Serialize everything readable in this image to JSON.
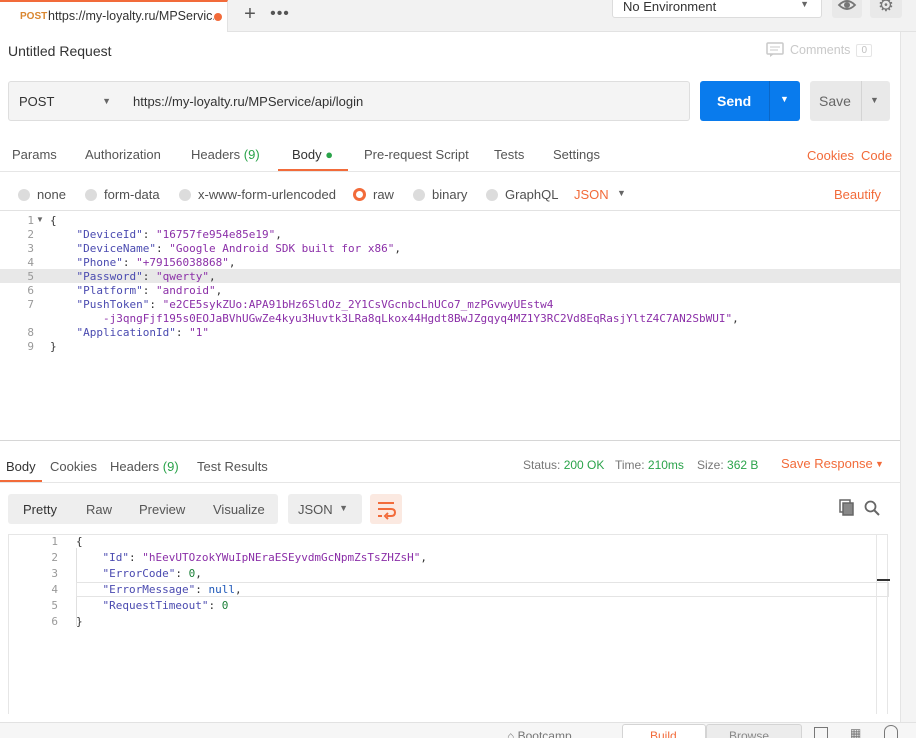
{
  "tab": {
    "method": "POST",
    "url": "https://my-loyalty.ru/MPServic..."
  },
  "topbar": {
    "add_label": "+",
    "more_label": "•••",
    "environment": "No Environment"
  },
  "request": {
    "title": "Untitled Request",
    "comments_label": "Comments",
    "comments_count": "0",
    "method": "POST",
    "url": "https://my-loyalty.ru/MPService/api/login",
    "send_label": "Send",
    "save_label": "Save"
  },
  "request_tabs": {
    "params": "Params",
    "authorization": "Authorization",
    "headers": "Headers",
    "headers_count": "(9)",
    "body": "Body",
    "prerequest": "Pre-request Script",
    "tests": "Tests",
    "settings": "Settings",
    "cookies": "Cookies",
    "code": "Code"
  },
  "body_options": {
    "none": "none",
    "form_data": "form-data",
    "urlencoded": "x-www-form-urlencoded",
    "raw": "raw",
    "binary": "binary",
    "graphql": "GraphQL",
    "format": "JSON",
    "beautify": "Beautify"
  },
  "request_body": {
    "line_numbers": [
      "1",
      "2",
      "3",
      "4",
      "5",
      "6",
      "7",
      "",
      "8",
      "9"
    ],
    "open": "{",
    "close": "}",
    "fields": [
      {
        "key": "\"DeviceId\"",
        "value": "\"16757fe954e85e19\""
      },
      {
        "key": "\"DeviceName\"",
        "value": "\"Google Android SDK built for x86\""
      },
      {
        "key": "\"Phone\"",
        "value": "\"+79156038868\""
      },
      {
        "key": "\"Password\"",
        "value": "\"qwerty\""
      },
      {
        "key": "\"Platform\"",
        "value": "\"android\""
      },
      {
        "key": "\"PushToken\"",
        "value": "\"e2CE5sykZUo:APA91bHz6SldOz_2Y1CsVGcnbcLhUCo7_mzPGvwyUEstw4"
      },
      {
        "key": "",
        "value": "-j3qngFjf195s0EOJaBVhUGwZe4kyu3Huvtk3LRa8qLkox44Hgdt8BwJZgqyq4MZ1Y3RC2Vd8EqRasjYltZ4C7AN2SbWUI\""
      },
      {
        "key": "\"ApplicationId\"",
        "value": "\"1\""
      }
    ]
  },
  "response_tabs": {
    "body": "Body",
    "cookies": "Cookies",
    "headers": "Headers",
    "headers_count": "(9)",
    "test_results": "Test Results"
  },
  "response_meta": {
    "status_label": "Status:",
    "status_value": "200 OK",
    "time_label": "Time:",
    "time_value": "210ms",
    "size_label": "Size:",
    "size_value": "362 B",
    "save_response": "Save Response"
  },
  "response_view": {
    "pretty": "Pretty",
    "raw": "Raw",
    "preview": "Preview",
    "visualize": "Visualize",
    "format": "JSON"
  },
  "response_body": {
    "line_numbers": [
      "1",
      "2",
      "3",
      "4",
      "5",
      "6"
    ],
    "open": "{",
    "close": "}",
    "id_key": "\"Id\"",
    "id_value": "\"hEevUTOzokYWuIpNEraESEyvdmGcNpmZsTsZHZsH\"",
    "error_code_key": "\"ErrorCode\"",
    "error_code_value": "0",
    "error_message_key": "\"ErrorMessage\"",
    "error_message_value": "null",
    "timeout_key": "\"RequestTimeout\"",
    "timeout_value": "0"
  },
  "statusbar": {
    "bootcamp": "Bootcamp",
    "build": "Build",
    "browse": "Browse"
  },
  "colors": {
    "accent": "#f26b3a",
    "send": "#097bed",
    "status_ok": "#2aa34a"
  }
}
